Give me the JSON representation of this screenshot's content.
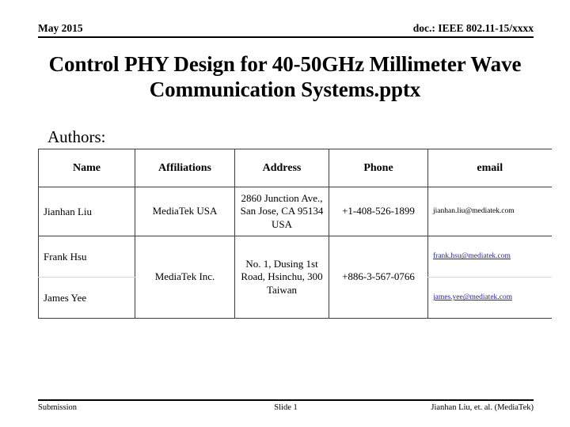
{
  "header": {
    "date": "May 2015",
    "doc_id": "doc.: IEEE 802.11-15/xxxx"
  },
  "title": "Control PHY Design for 40-50GHz Millimeter Wave Communication Systems.pptx",
  "authors_section": {
    "label": "Authors:",
    "columns": [
      "Name",
      "Affiliations",
      "Address",
      "Phone",
      "email"
    ],
    "rows": [
      {
        "name": "Jianhan Liu",
        "affiliation": "MediaTek USA",
        "address": "2860 Junction Ave., San Jose, CA 95134 USA",
        "phone": "+1-408-526-1899",
        "email": "jianhan.liu@mediatek.com",
        "email_is_link": false
      },
      {
        "name": "Frank Hsu",
        "affiliation": "MediaTek Inc.",
        "address": "No. 1, Dusing 1st Road, Hsinchu, 300 Taiwan",
        "phone": "+886-3-567-0766",
        "email": "frank.hsu@mediatek.com",
        "email_is_link": true
      },
      {
        "name": "James Yee",
        "affiliation": "MediaTek Inc.",
        "address": "No. 1, Dusing 1st Road, Hsinchu, 300 Taiwan",
        "phone": "+886-3-567-0766",
        "email": "james.yee@mediatek.com",
        "email_is_link": true
      }
    ]
  },
  "footer": {
    "left": "Submission",
    "center": "Slide 1",
    "right": "Jianhan Liu, et. al. (MediaTek)"
  },
  "colors": {
    "link": "#2222aa",
    "text": "#000000",
    "rule": "#000000",
    "table_border": "#3d3d3d",
    "table_inner_divider": "#d8d8d8"
  }
}
